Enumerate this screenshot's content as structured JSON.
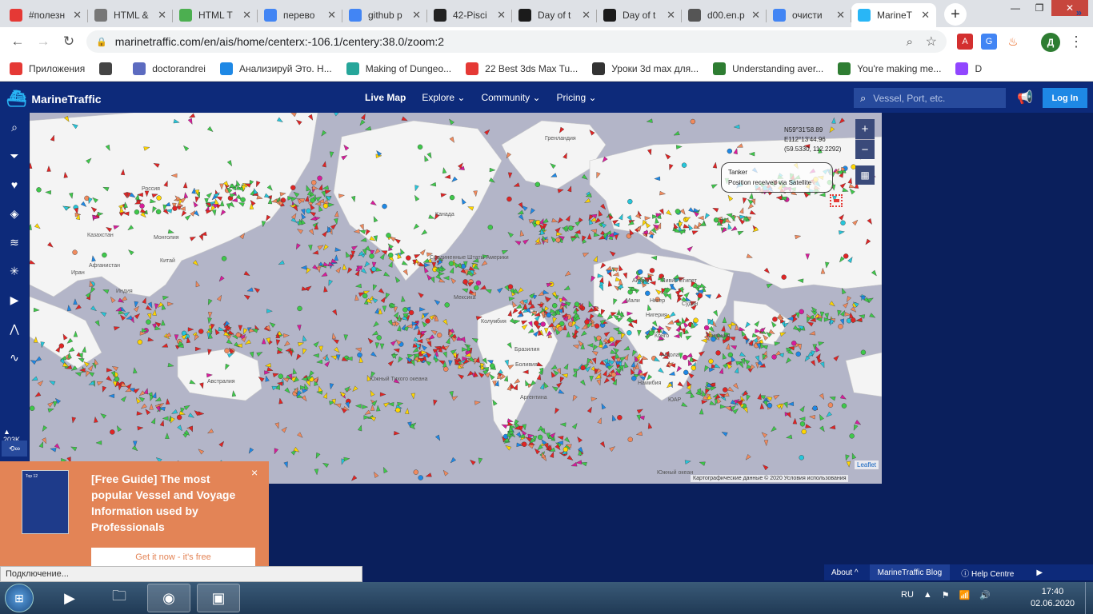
{
  "browser": {
    "tabs": [
      {
        "label": "#полезн",
        "icon": "youtube-icon",
        "color": "#e53935",
        "active": false
      },
      {
        "label": "HTML &",
        "icon": "globe-icon",
        "color": "#777777",
        "active": false
      },
      {
        "label": "HTML T",
        "icon": "w3-icon",
        "color": "#4caf50",
        "active": false
      },
      {
        "label": "перево",
        "icon": "google-icon",
        "color": "#4285f4",
        "active": false
      },
      {
        "label": "github p",
        "icon": "google-icon",
        "color": "#4285f4",
        "active": false
      },
      {
        "label": "42-Pisci",
        "icon": "github-icon",
        "color": "#222222",
        "active": false
      },
      {
        "label": "Day of t",
        "icon": "pycharm-icon",
        "color": "#1b1b1b",
        "active": false
      },
      {
        "label": "Day of t",
        "icon": "pycharm-icon",
        "color": "#1b1b1b",
        "active": false
      },
      {
        "label": "d00.en.p",
        "icon": "globe-icon",
        "color": "#555555",
        "active": false
      },
      {
        "label": "очисти",
        "icon": "google-icon",
        "color": "#4285f4",
        "active": false
      },
      {
        "label": "MarineT",
        "icon": "marinetraffic-icon",
        "color": "#29b6f6",
        "active": true
      }
    ],
    "new_tab": "+",
    "url": "marinetraffic.com/en/ais/home/centerx:-106.1/centery:38.0/zoom:2",
    "profile_initial": "Д",
    "bookmarks": [
      {
        "label": "Приложения",
        "icon": "apps-grid-icon",
        "color": "#e53935"
      },
      {
        "label": "",
        "icon": "globe-icon",
        "color": "#444444"
      },
      {
        "label": "doctorandrei",
        "icon": "person-icon",
        "color": "#5c6bc0"
      },
      {
        "label": "Анализируй Это. Н...",
        "icon": "shield-icon",
        "color": "#1e88e5"
      },
      {
        "label": "Making of Dungeo...",
        "icon": "cgt-icon",
        "color": "#26a69a"
      },
      {
        "label": "22 Best 3ds Max Tu...",
        "icon": "grid-dots-icon",
        "color": "#e53935"
      },
      {
        "label": "Уроки 3d max для...",
        "icon": "cube-icon",
        "color": "#333333"
      },
      {
        "label": "Understanding aver...",
        "icon": "youtube-channel-icon",
        "color": "#2e7d32"
      },
      {
        "label": "You're making me...",
        "icon": "youtube-channel-icon",
        "color": "#2e7d32"
      },
      {
        "label": "D",
        "icon": "twitch-icon",
        "color": "#9146ff"
      }
    ],
    "bookmarks_more": "»"
  },
  "site": {
    "brand": "MarineTraffic",
    "nav": [
      "Live Map",
      "Explore ⌄",
      "Community ⌄",
      "Pricing ⌄"
    ],
    "search_placeholder": "Vessel, Port, etc.",
    "login_label": "Log In",
    "sidebar_icons": [
      "search-icon",
      "filter-icon",
      "heart-icon",
      "layers-icon",
      "wind-icon",
      "measure-icon",
      "play-icon",
      "compass-icon",
      "chart-icon"
    ],
    "vessel_count": "203K",
    "infinity_label": "∞"
  },
  "map": {
    "labels": [
      {
        "text": "Россия"
      },
      {
        "text": "Казахстан"
      },
      {
        "text": "Монголия"
      },
      {
        "text": "Китай"
      },
      {
        "text": "Афганистан"
      },
      {
        "text": "Иран"
      },
      {
        "text": "Индия"
      },
      {
        "text": "Австралия"
      },
      {
        "text": "Гренландия"
      },
      {
        "text": "Канада"
      },
      {
        "text": "Соединенные Штаты Америки"
      },
      {
        "text": "Мексика"
      },
      {
        "text": "Колумбия"
      },
      {
        "text": "Бразилия"
      },
      {
        "text": "Боливия"
      },
      {
        "text": "Аргентина"
      },
      {
        "text": "Алжир"
      },
      {
        "text": "Ливия"
      },
      {
        "text": "Египет"
      },
      {
        "text": "Мали"
      },
      {
        "text": "Нигер"
      },
      {
        "text": "Судан"
      },
      {
        "text": "Нигерия"
      },
      {
        "text": "Конго"
      },
      {
        "text": "Танзания"
      },
      {
        "text": "Ангола"
      },
      {
        "text": "Намибия"
      },
      {
        "text": "ЮАР"
      },
      {
        "text": "Южный океан"
      },
      {
        "text": "Южный Тихого океана"
      }
    ],
    "coords": [
      "N59°31'58.89",
      "E112°13'44.96",
      "(59.5330, 112.2292)"
    ],
    "zoom_in": "+",
    "zoom_out": "−",
    "tooltip_title": "Tanker",
    "tooltip_text": "Position received via Satellite",
    "attribution": "Картографические данные © 2020   Условия использования",
    "leaflet": "Leaflet",
    "vessel_colors": {
      "cargo": "#3ec84a",
      "tanker": "#e02424",
      "passenger": "#1e88e5",
      "unknown": "#f08a5d",
      "highspeed": "#ffd600",
      "tug": "#26c6da",
      "pleasure": "#d81b9b"
    }
  },
  "promo": {
    "title": "[Free Guide] The most popular Vessel and Voyage Information used by Professionals",
    "cta": "Get it now - it's free",
    "close": "×",
    "thumb_title": "Top 12"
  },
  "status_bar": "Подключение...",
  "footer": {
    "about": "About ^",
    "blog": "MarineTraffic Blog",
    "help": "Help Centre"
  },
  "taskbar": {
    "lang": "RU",
    "time": "17:40",
    "date": "02.06.2020"
  }
}
